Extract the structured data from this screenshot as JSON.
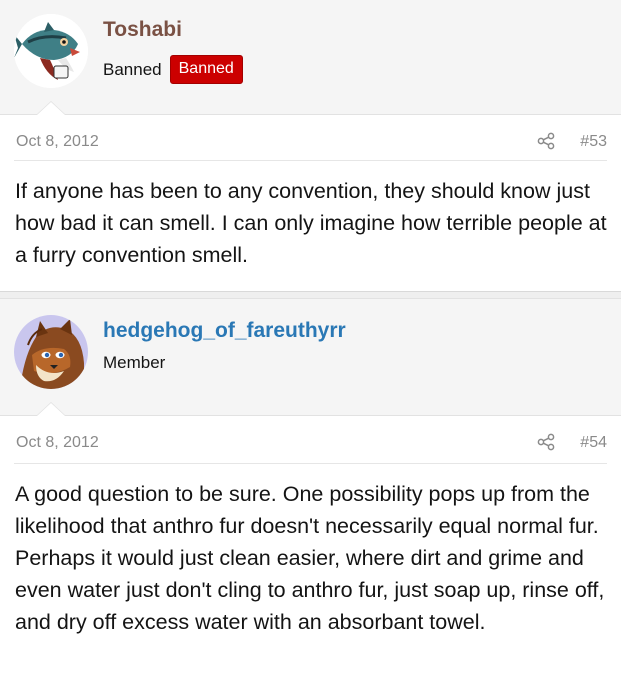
{
  "posts": [
    {
      "author": "Toshabi",
      "user_title": "Banned",
      "banner": "Banned",
      "avatar_icon": "fish-avatar-icon",
      "date": "Oct 8, 2012",
      "share_icon": "share-icon",
      "number": "#53",
      "text": "If anyone has been to any convention, they should know just how bad it can smell. I can only imagine how terrible people at a furry convention smell."
    },
    {
      "author": "hedgehog_of_fareuthyrr",
      "user_title": "Member",
      "avatar_icon": "wolf-avatar-icon",
      "date": "Oct 8, 2012",
      "share_icon": "share-icon",
      "number": "#54",
      "text": "A good question to be sure. One possibility pops up from the likelihood that anthro fur doesn't necessarily equal normal fur. Perhaps it would just clean easier, where dirt and grime and even water just don't cling to anthro fur, just soap up, rinse off, and dry off excess water with an absorbant towel."
    }
  ],
  "colors": {
    "banned_name": "#7a5144",
    "member_name": "#2a78b5",
    "banner_bg": "#cc0000",
    "meta_text": "#8a8a8a"
  }
}
